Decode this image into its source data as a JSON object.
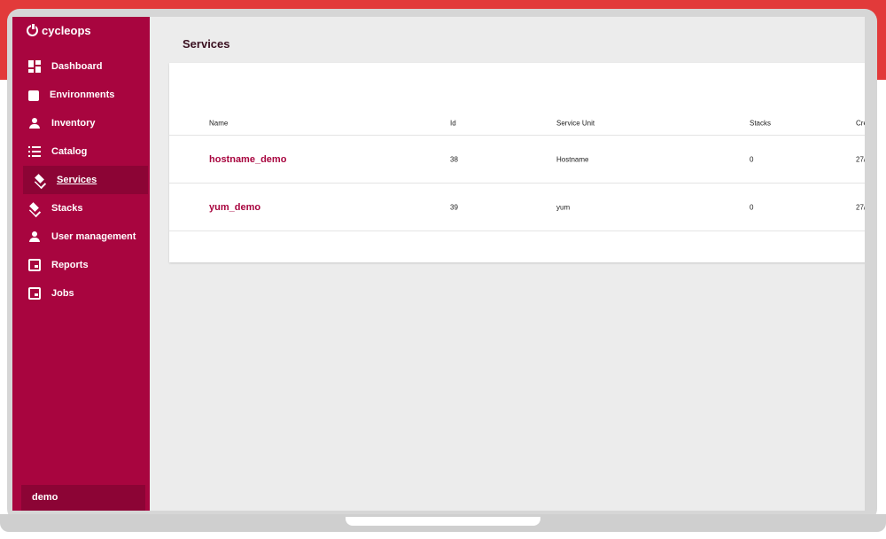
{
  "brand": {
    "name": "cycleops",
    "accent": "#a8053f"
  },
  "sidebar": {
    "items": [
      {
        "label": "Dashboard",
        "icon": "dashboard-icon"
      },
      {
        "label": "Environments",
        "icon": "puzzle-icon"
      },
      {
        "label": "Inventory",
        "icon": "person-icon"
      },
      {
        "label": "Catalog",
        "icon": "list-icon"
      },
      {
        "label": "Services",
        "icon": "layers-icon",
        "active": true
      },
      {
        "label": "Stacks",
        "icon": "layers-icon"
      },
      {
        "label": "User management",
        "icon": "person-icon"
      },
      {
        "label": "Reports",
        "icon": "calendar-icon"
      },
      {
        "label": "Jobs",
        "icon": "calendar-icon"
      }
    ],
    "user": "demo"
  },
  "main": {
    "title": "Services",
    "table": {
      "columns": [
        "Name",
        "Id",
        "Service Unit",
        "Stacks",
        "Cre"
      ],
      "rows": [
        {
          "name": "hostname_demo",
          "id": "38",
          "unit": "Hostname",
          "stacks": "0",
          "created": "27/"
        },
        {
          "name": "yum_demo",
          "id": "39",
          "unit": "yum",
          "stacks": "0",
          "created": "27/"
        }
      ]
    }
  }
}
